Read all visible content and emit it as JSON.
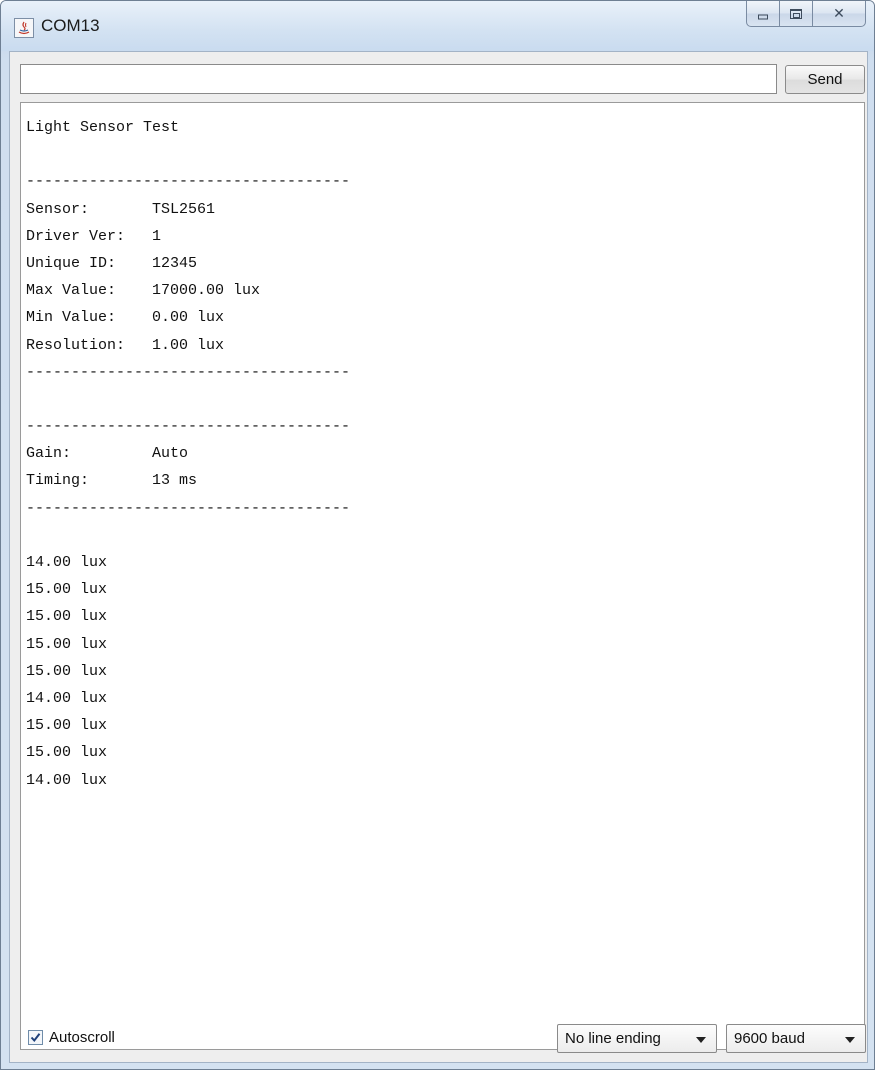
{
  "window": {
    "title": "COM13",
    "controls": {
      "minimize_icon": "minimize-icon",
      "maximize_icon": "maximize-icon",
      "close_icon": "close-icon"
    }
  },
  "input": {
    "value": "",
    "placeholder": ""
  },
  "send_button": {
    "label": "Send"
  },
  "output_lines": [
    "Light Sensor Test",
    "",
    "------------------------------------",
    "Sensor:       TSL2561",
    "Driver Ver:   1",
    "Unique ID:    12345",
    "Max Value:    17000.00 lux",
    "Min Value:    0.00 lux",
    "Resolution:   1.00 lux",
    "------------------------------------",
    "",
    "------------------------------------",
    "Gain:         Auto",
    "Timing:       13 ms",
    "------------------------------------",
    "",
    "14.00 lux",
    "15.00 lux",
    "15.00 lux",
    "15.00 lux",
    "15.00 lux",
    "14.00 lux",
    "15.00 lux",
    "15.00 lux",
    "14.00 lux"
  ],
  "footer": {
    "autoscroll_label": "Autoscroll",
    "autoscroll_checked": true,
    "line_ending_selected": "No line ending",
    "baud_selected": "9600 baud"
  }
}
